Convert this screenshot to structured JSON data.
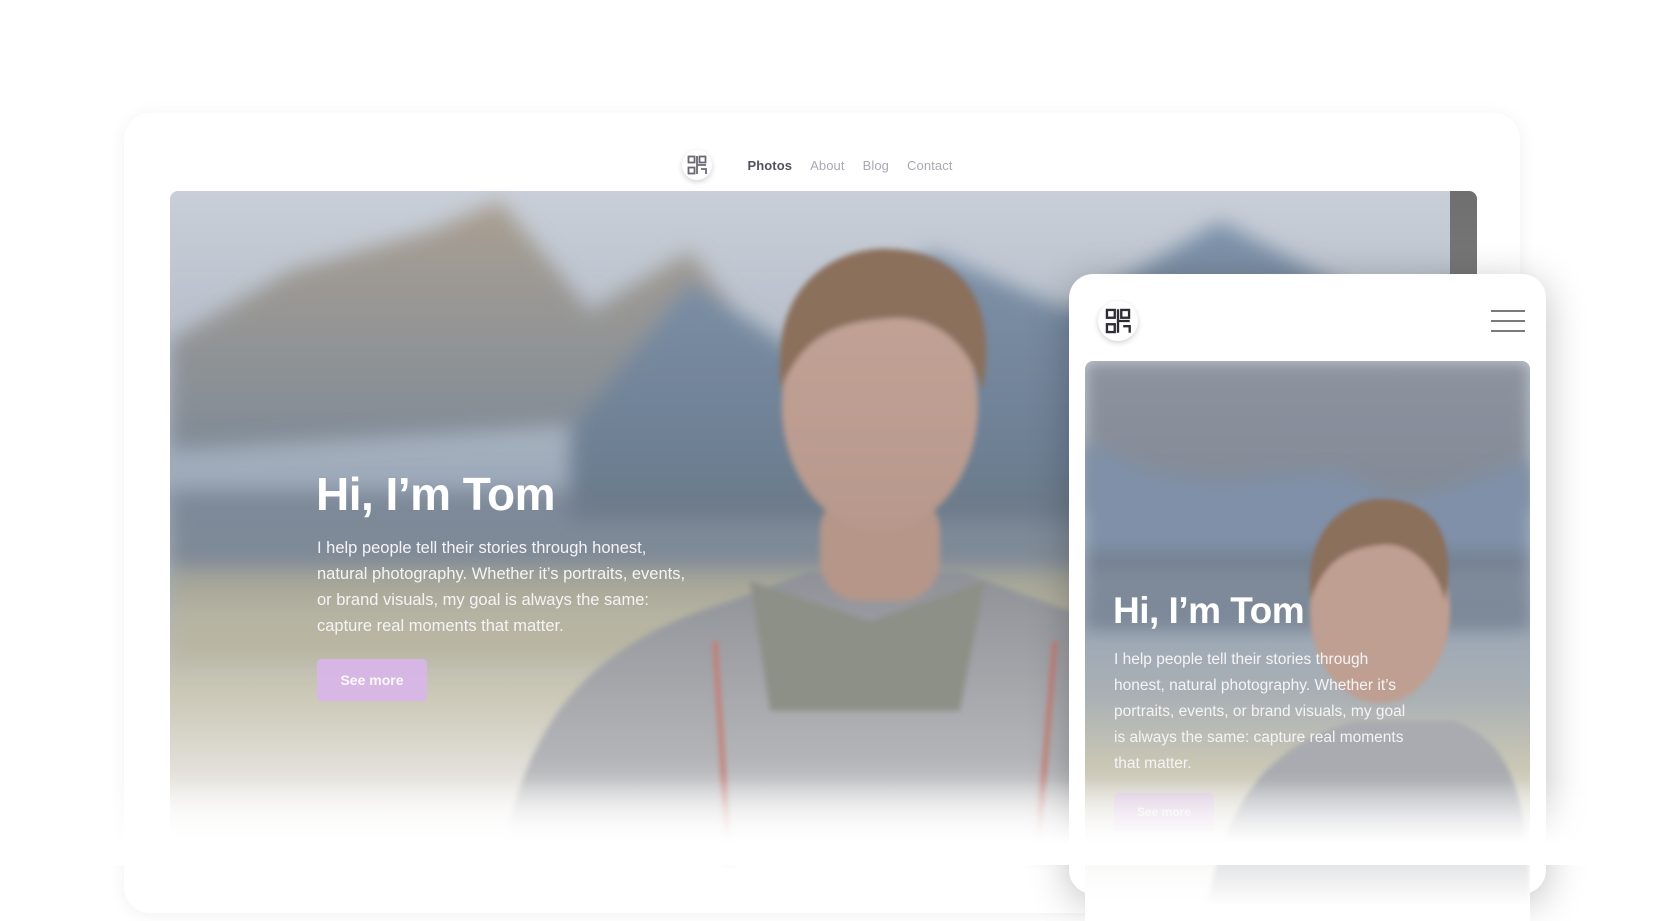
{
  "nav": {
    "logo": "brand-logo-icon",
    "links": [
      {
        "label": "Photos",
        "active": true
      },
      {
        "label": "About",
        "active": false
      },
      {
        "label": "Blog",
        "active": false
      },
      {
        "label": "Contact",
        "active": false
      }
    ]
  },
  "hero": {
    "title": "Hi, I’m Tom",
    "body": "I help people tell their stories through honest, natural photography. Whether it’s portraits, events, or brand visuals, my goal is always the same: capture real moments that matter.",
    "cta_label": "See more"
  },
  "mobile": {
    "menu_icon": "hamburger-menu-icon"
  },
  "colors": {
    "accent": "#d9b6ea",
    "nav_active": "#52525e",
    "nav_inactive": "#a9a9b4"
  }
}
